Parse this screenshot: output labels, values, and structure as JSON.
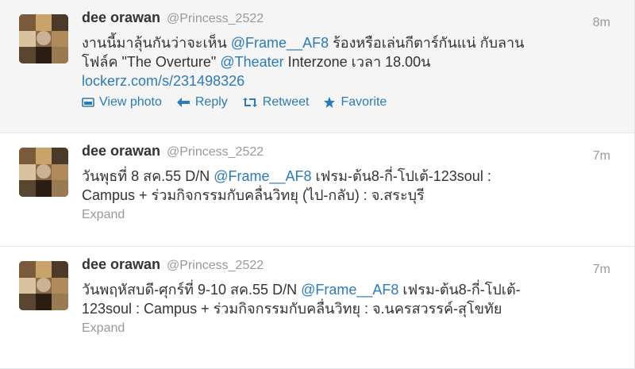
{
  "tweets": [
    {
      "fullname": "dee orawan",
      "username": "@Princess_2522",
      "time": "8m",
      "line1_a": "งานนี้มาลุ้นกันว่าจะเห็น ",
      "line1_mention": "@Frame__AF8",
      "line1_b": " ร้องหรือเล่นกีตาร์กันแน่ กับลาน",
      "line2_a": "โฟล์ค \"The Overture\" ",
      "line2_mention": "@Theater",
      "line2_b": " Interzone เวลา 18.00น",
      "line3_link": "lockerz.com/s/231498326",
      "actions": {
        "view_photo": "View photo",
        "reply": "Reply",
        "retweet": "Retweet",
        "favorite": "Favorite"
      }
    },
    {
      "fullname": "dee orawan",
      "username": "@Princess_2522",
      "time": "7m",
      "line1_a": "วันพุธที่ 8 สค.55 D/N ",
      "line1_mention": "@Frame__AF8",
      "line1_b": " เฟรม-ต้น8-กี่-โปเต้-123soul :",
      "line2": "Campus + ร่วมกิจกรรมกับคลื่นวิทยุ (ไป-กลับ) : จ.สระบุรี",
      "expand": "Expand"
    },
    {
      "fullname": "dee orawan",
      "username": "@Princess_2522",
      "time": "7m",
      "line1_a": "วันพฤหัสบดี-ศุกร์ที่ 9-10 สค.55 D/N ",
      "line1_mention": "@Frame__AF8",
      "line1_b": " เฟรม-ต้น8-กี่-โปเต้-",
      "line2": "123soul : Campus + ร่วมกิจกรรมกับคลื่นวิทยุ : จ.นครสวรรค์-สุโขทัย",
      "expand": "Expand"
    }
  ],
  "colors": {
    "link": "#2b7bb9",
    "meta": "#999999",
    "text": "#333333",
    "highlight_bg": "#f5f5f5"
  },
  "icons": {
    "view_photo": "photo-icon",
    "reply": "reply-arrow-icon",
    "retweet": "retweet-icon",
    "favorite": "star-icon"
  }
}
